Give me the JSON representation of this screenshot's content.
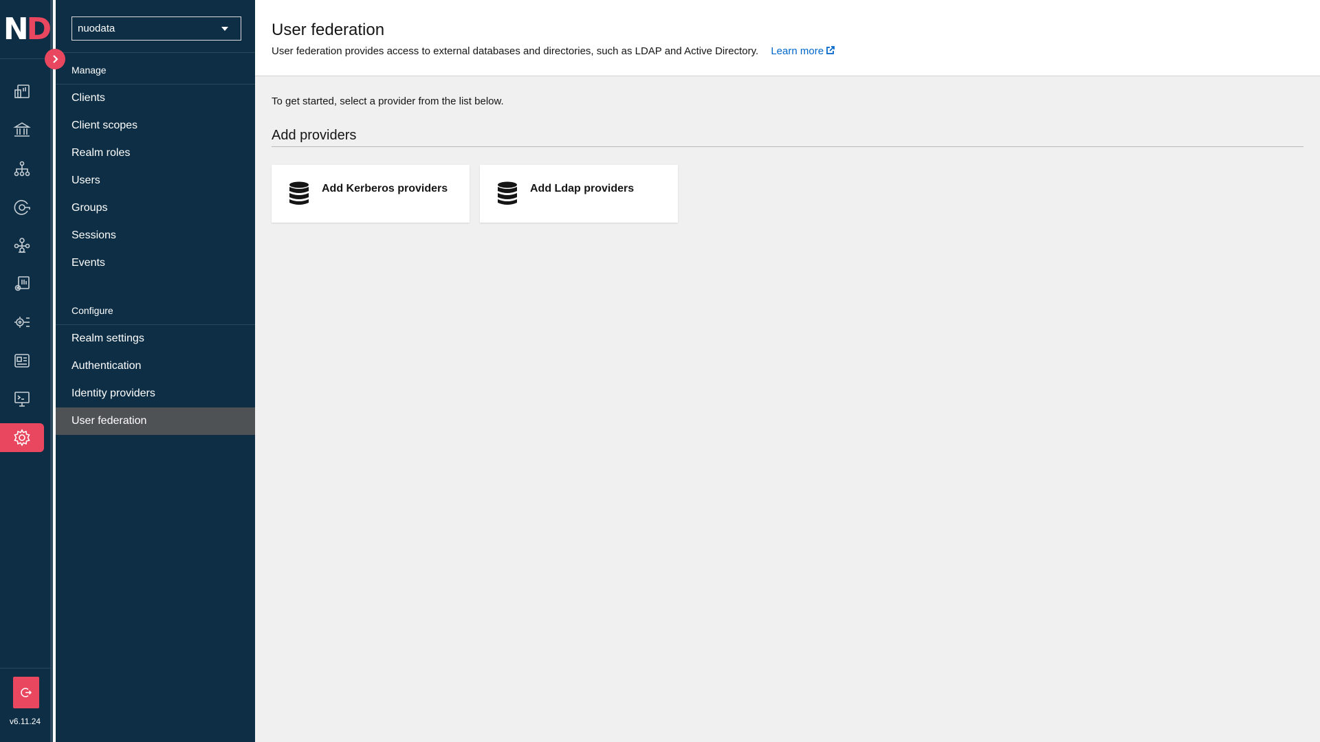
{
  "app": {
    "logo_letters": [
      "N",
      "D"
    ],
    "version": "v6.11.24",
    "colors": {
      "sidebar": "#0d2e45",
      "accent": "#e8475f",
      "link": "#0066cc",
      "content_bg": "#f0f0f0",
      "active_nav": "#4f5255"
    }
  },
  "rail": {
    "items": [
      {
        "icon": "dashboard-icon"
      },
      {
        "icon": "bank-icon"
      },
      {
        "icon": "hierarchy-icon"
      },
      {
        "icon": "access-icon"
      },
      {
        "icon": "network-icon"
      },
      {
        "icon": "reports-settings-icon"
      },
      {
        "icon": "integration-icon"
      },
      {
        "icon": "id-card-icon"
      },
      {
        "icon": "console-icon"
      },
      {
        "icon": "gear-icon",
        "active": true
      }
    ],
    "bottom_icon": "logout-icon"
  },
  "realm_selector": {
    "value": "nuodata"
  },
  "nav": {
    "manage_heading": "Manage",
    "manage_items": [
      "Clients",
      "Client scopes",
      "Realm roles",
      "Users",
      "Groups",
      "Sessions",
      "Events"
    ],
    "configure_heading": "Configure",
    "configure_items": [
      "Realm settings",
      "Authentication",
      "Identity providers",
      "User federation"
    ],
    "active_item": "User federation"
  },
  "page": {
    "title": "User federation",
    "description": "User federation provides access to external databases and directories, such as LDAP and Active Directory.",
    "learn_more": "Learn more",
    "intro": "To get started, select a provider from the list below.",
    "providers_heading": "Add providers",
    "providers": [
      {
        "label": "Add Kerberos providers",
        "icon": "database-icon"
      },
      {
        "label": "Add Ldap providers",
        "icon": "database-icon"
      }
    ]
  }
}
